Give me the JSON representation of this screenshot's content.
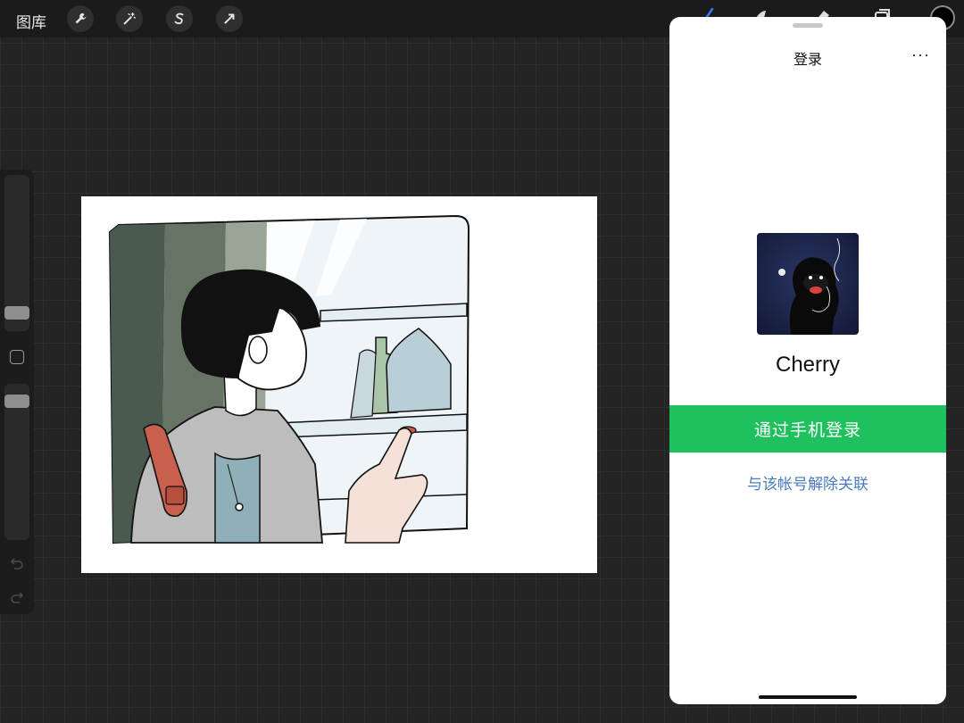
{
  "topbar": {
    "gallery_label": "图库",
    "tools": [
      "wrench-icon",
      "magic-wand-icon",
      "selection-icon",
      "transform-arrow-icon"
    ],
    "right_tools": [
      "brush-icon",
      "smudge-icon",
      "eraser-icon",
      "layers-icon"
    ],
    "active_color": "#000000"
  },
  "sidebar": {
    "controls": [
      "brush-size-slider",
      "modifier-button",
      "opacity-slider",
      "undo-icon",
      "redo-icon"
    ]
  },
  "login_sheet": {
    "title": "登录",
    "more": "···",
    "username": "Cherry",
    "primary_button": "通过手机登录",
    "secondary_link": "与该帐号解除关联",
    "accent": "#1fc05e",
    "link_color": "#4a7bbf"
  }
}
